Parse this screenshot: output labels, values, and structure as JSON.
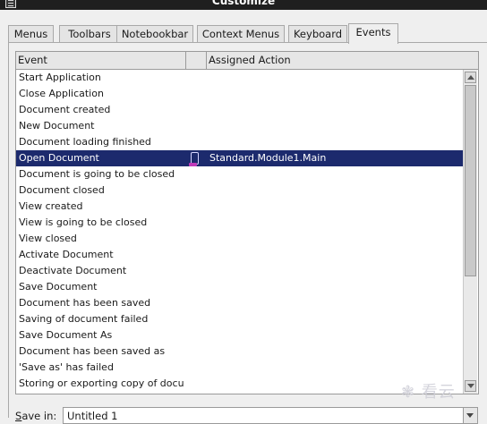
{
  "window": {
    "title": "Customize"
  },
  "tabs": [
    {
      "label": "Menus",
      "active": false
    },
    {
      "label": "Toolbars",
      "active": false
    },
    {
      "label": "Notebookbar",
      "active": false
    },
    {
      "label": "Context Menus",
      "active": false
    },
    {
      "label": "Keyboard",
      "active": false
    },
    {
      "label": "Events",
      "active": true
    }
  ],
  "table": {
    "headers": {
      "event": "Event",
      "assigned_action": "Assigned Action"
    },
    "selected_index": 5,
    "rows": [
      {
        "event": "Start Application",
        "action": ""
      },
      {
        "event": "Close Application",
        "action": ""
      },
      {
        "event": "Document created",
        "action": ""
      },
      {
        "event": "New Document",
        "action": ""
      },
      {
        "event": "Document loading finished",
        "action": ""
      },
      {
        "event": "Open Document",
        "action": "Standard.Module1.Main"
      },
      {
        "event": "Document is going to be closed",
        "action": ""
      },
      {
        "event": "Document closed",
        "action": ""
      },
      {
        "event": "View created",
        "action": ""
      },
      {
        "event": "View is going to be closed",
        "action": ""
      },
      {
        "event": "View closed",
        "action": ""
      },
      {
        "event": "Activate Document",
        "action": ""
      },
      {
        "event": "Deactivate Document",
        "action": ""
      },
      {
        "event": "Save Document",
        "action": ""
      },
      {
        "event": "Document has been saved",
        "action": ""
      },
      {
        "event": "Saving of document failed",
        "action": ""
      },
      {
        "event": "Save Document As",
        "action": ""
      },
      {
        "event": "Document has been saved as",
        "action": ""
      },
      {
        "event": "'Save as' has failed",
        "action": ""
      },
      {
        "event": "Storing or exporting copy of docu",
        "action": ""
      }
    ]
  },
  "save_in": {
    "label_accel": "S",
    "label_rest": "ave in:",
    "value": "Untitled 1"
  },
  "watermark": {
    "text": "❃ 看云"
  },
  "icons": {
    "app": "customize-dialog-icon",
    "scroll_up": "scroll-up-arrow-icon",
    "scroll_down": "scroll-down-arrow-icon",
    "dropdown": "chevron-down-icon",
    "row_marker": "macro-assigned-icon"
  },
  "colors": {
    "selection": "#1c2a6d",
    "titlebar": "#1f1f1f"
  }
}
